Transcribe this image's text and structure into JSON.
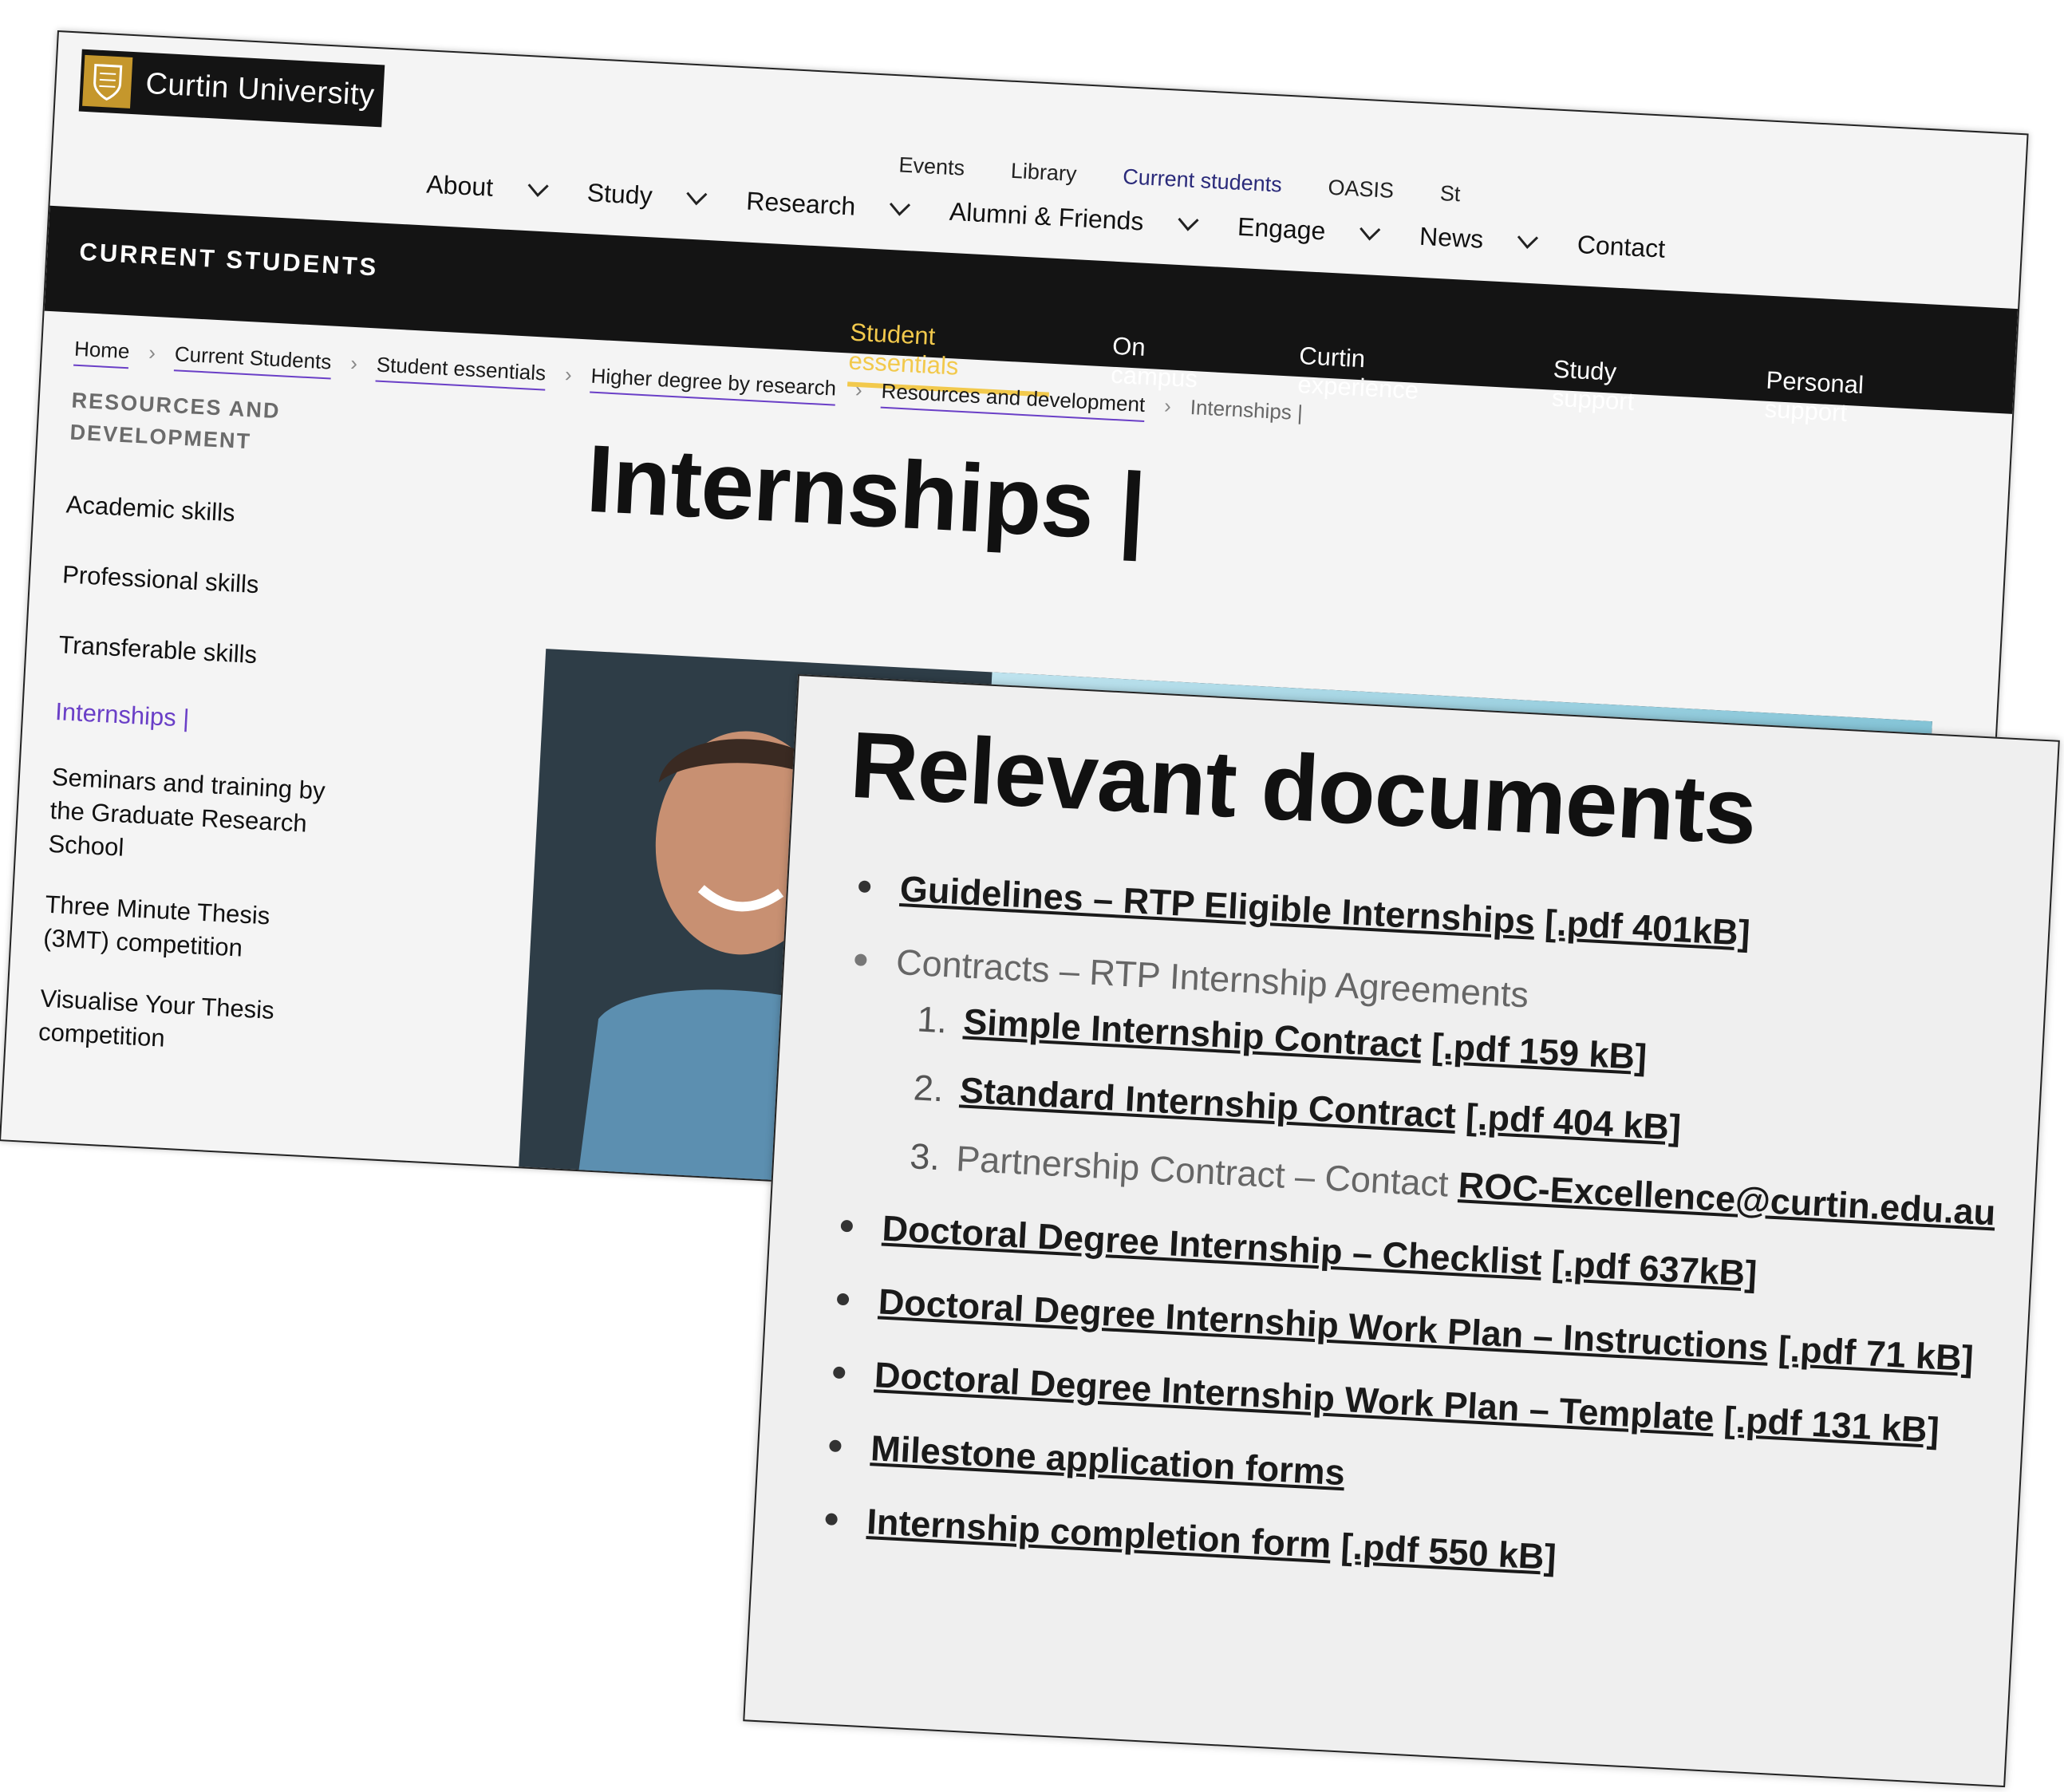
{
  "brand": {
    "name": "Curtin University"
  },
  "utility_nav": [
    "Events",
    "Library",
    "Current students",
    "OASIS",
    "St"
  ],
  "main_nav": [
    "About",
    "Study",
    "Research",
    "Alumni & Friends",
    "Engage",
    "News",
    "Contact"
  ],
  "section": {
    "name": "CURRENT STUDENTS"
  },
  "sub_nav": [
    "Student essentials",
    "On campus",
    "Curtin experience",
    "Study support",
    "Personal support"
  ],
  "breadcrumb": [
    "Home",
    "Current Students",
    "Student essentials",
    "Higher degree by research",
    "Resources and development",
    "Internships |"
  ],
  "sidebar": {
    "heading_line1": "RESOURCES AND",
    "heading_line2": "DEVELOPMENT",
    "items": [
      "Academic skills",
      "Professional skills",
      "Transferable skills",
      "Internships |",
      "Seminars and training by the Graduate Research School",
      "Three Minute Thesis (3MT) competition",
      "Visualise Your Thesis competition"
    ]
  },
  "page": {
    "title": "Internships |"
  },
  "documents": {
    "title": "Relevant documents",
    "item1": {
      "text": "Guidelines – RTP Eligible Internships",
      "suffix": "[.pdf 401kB]"
    },
    "item2": {
      "text": "Contracts – RTP Internship Agreements"
    },
    "contracts": [
      {
        "num": "1.",
        "text": "Simple Internship Contract",
        "suffix": "[.pdf 159 kB]"
      },
      {
        "num": "2.",
        "text": "Standard Internship Contract",
        "suffix": "[.pdf 404 kB]"
      },
      {
        "num": "3.",
        "text": "Partnership Contract – Contact",
        "email": "ROC-Excellence@curtin.edu.au"
      }
    ],
    "item3": {
      "text": "Doctoral Degree Internship – Checklist",
      "suffix": "[.pdf 637kB]"
    },
    "item4": {
      "text": "Doctoral Degree Internship Work Plan – Instructions",
      "suffix": "[.pdf 71 kB]"
    },
    "item5": {
      "text": "Doctoral Degree Internship Work Plan – Template",
      "suffix": "[.pdf 131 kB]"
    },
    "item6": {
      "text": "Milestone application forms"
    },
    "item7": {
      "text": "Internship completion form",
      "suffix": "[.pdf 550 kB]"
    }
  },
  "colors": {
    "accent_purple": "#6a3fc7",
    "accent_gold": "#f2c94c",
    "brand_gold": "#c5972c",
    "bar_black": "#141414"
  },
  "icons": [
    "shield-logo-icon",
    "chevron-down-icon"
  ]
}
